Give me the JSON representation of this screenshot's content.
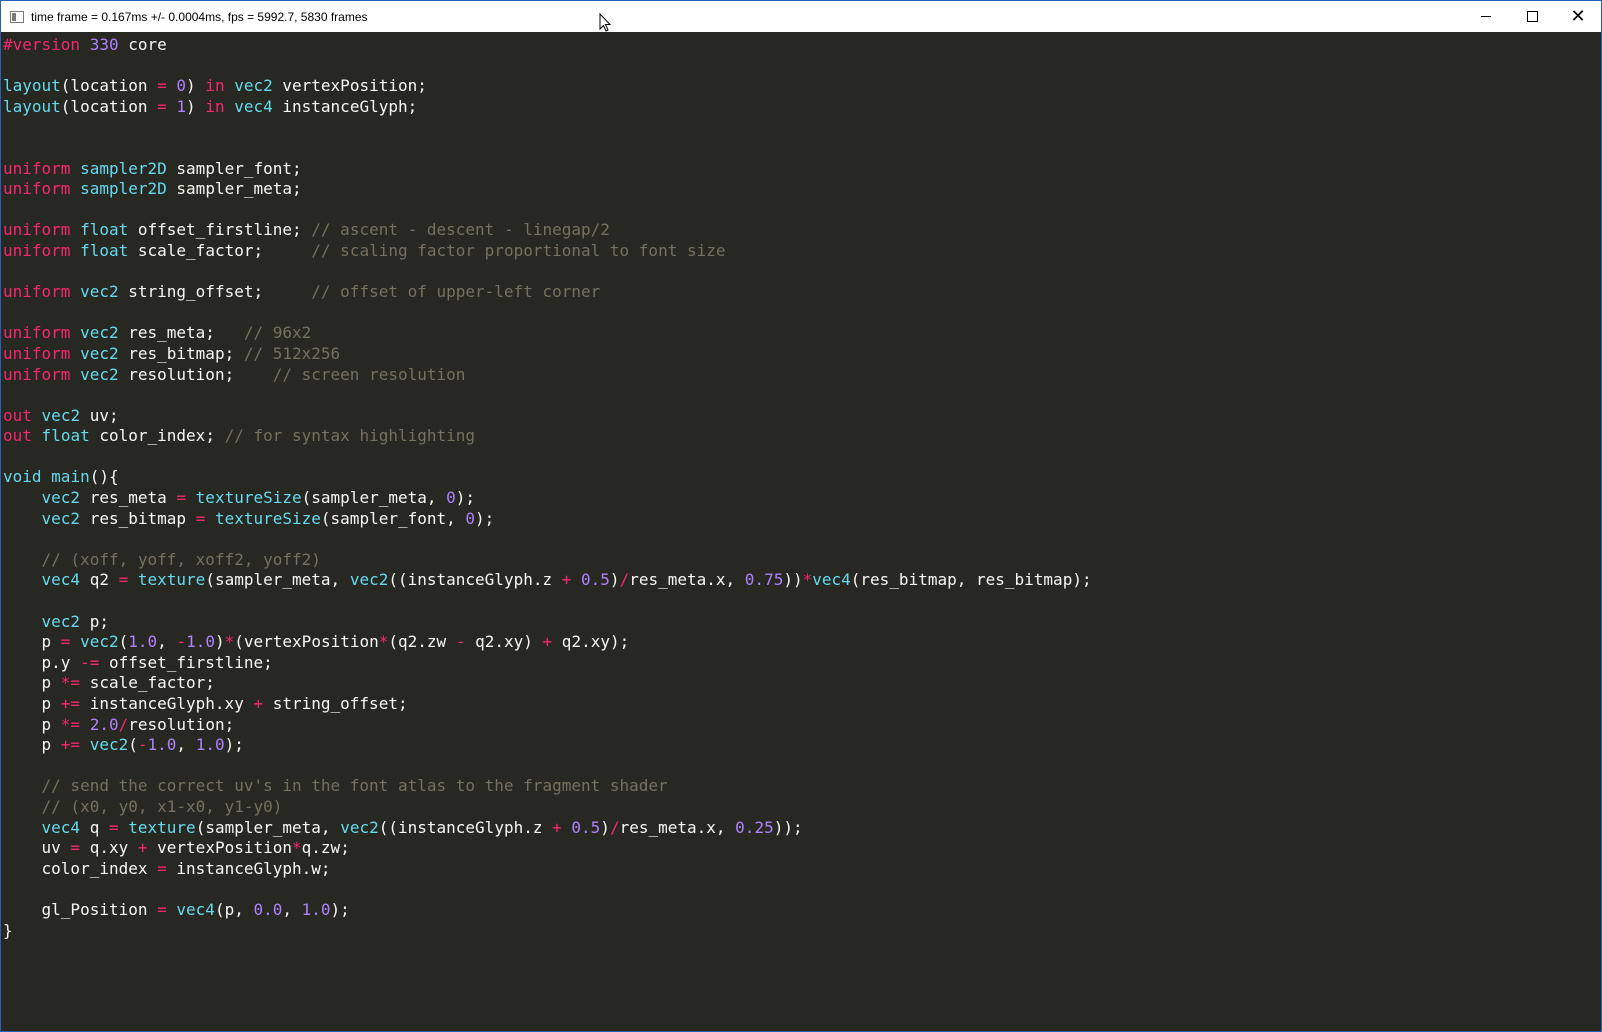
{
  "window": {
    "title": "time frame = 0.167ms +/- 0.0004ms, fps = 5992.7, 5830 frames",
    "controls": {
      "minimize": "minimize",
      "maximize": "maximize",
      "close": "close"
    }
  },
  "colors": {
    "background": "#272822",
    "keyword": "#f92672",
    "type": "#66d9ef",
    "number": "#ae81ff",
    "comment": "#75715e",
    "text": "#f8f8f2"
  },
  "editor": {
    "lines": [
      [
        [
          "kw",
          "#version "
        ],
        [
          "num",
          "330"
        ],
        [
          "tx",
          " core"
        ]
      ],
      [],
      [
        [
          "ty",
          "layout"
        ],
        [
          "tx",
          "(location "
        ],
        [
          "op",
          "="
        ],
        [
          "tx",
          " "
        ],
        [
          "num",
          "0"
        ],
        [
          "tx",
          ") "
        ],
        [
          "kw",
          "in"
        ],
        [
          "tx",
          " "
        ],
        [
          "ty",
          "vec2"
        ],
        [
          "tx",
          " vertexPosition;"
        ]
      ],
      [
        [
          "ty",
          "layout"
        ],
        [
          "tx",
          "(location "
        ],
        [
          "op",
          "="
        ],
        [
          "tx",
          " "
        ],
        [
          "num",
          "1"
        ],
        [
          "tx",
          ") "
        ],
        [
          "kw",
          "in"
        ],
        [
          "tx",
          " "
        ],
        [
          "ty",
          "vec4"
        ],
        [
          "tx",
          " instanceGlyph;"
        ]
      ],
      [],
      [],
      [
        [
          "kw",
          "uniform"
        ],
        [
          "tx",
          " "
        ],
        [
          "ty",
          "sampler2D"
        ],
        [
          "tx",
          " sampler_font;"
        ]
      ],
      [
        [
          "kw",
          "uniform"
        ],
        [
          "tx",
          " "
        ],
        [
          "ty",
          "sampler2D"
        ],
        [
          "tx",
          " sampler_meta;"
        ]
      ],
      [],
      [
        [
          "kw",
          "uniform"
        ],
        [
          "tx",
          " "
        ],
        [
          "ty",
          "float"
        ],
        [
          "tx",
          " offset_firstline; "
        ],
        [
          "cm",
          "// ascent - descent - linegap/2"
        ]
      ],
      [
        [
          "kw",
          "uniform"
        ],
        [
          "tx",
          " "
        ],
        [
          "ty",
          "float"
        ],
        [
          "tx",
          " scale_factor;     "
        ],
        [
          "cm",
          "// scaling factor proportional to font size"
        ]
      ],
      [],
      [
        [
          "kw",
          "uniform"
        ],
        [
          "tx",
          " "
        ],
        [
          "ty",
          "vec2"
        ],
        [
          "tx",
          " string_offset;     "
        ],
        [
          "cm",
          "// offset of upper-left corner"
        ]
      ],
      [],
      [
        [
          "kw",
          "uniform"
        ],
        [
          "tx",
          " "
        ],
        [
          "ty",
          "vec2"
        ],
        [
          "tx",
          " res_meta;   "
        ],
        [
          "cm",
          "// 96x2"
        ]
      ],
      [
        [
          "kw",
          "uniform"
        ],
        [
          "tx",
          " "
        ],
        [
          "ty",
          "vec2"
        ],
        [
          "tx",
          " res_bitmap; "
        ],
        [
          "cm",
          "// 512x256"
        ]
      ],
      [
        [
          "kw",
          "uniform"
        ],
        [
          "tx",
          " "
        ],
        [
          "ty",
          "vec2"
        ],
        [
          "tx",
          " resolution;    "
        ],
        [
          "cm",
          "// screen resolution"
        ]
      ],
      [],
      [
        [
          "kw",
          "out"
        ],
        [
          "tx",
          " "
        ],
        [
          "ty",
          "vec2"
        ],
        [
          "tx",
          " uv;"
        ]
      ],
      [
        [
          "kw",
          "out"
        ],
        [
          "tx",
          " "
        ],
        [
          "ty",
          "float"
        ],
        [
          "tx",
          " color_index; "
        ],
        [
          "cm",
          "// for syntax highlighting"
        ]
      ],
      [],
      [
        [
          "ty",
          "void"
        ],
        [
          "tx",
          " "
        ],
        [
          "ty",
          "main"
        ],
        [
          "tx",
          "(){"
        ]
      ],
      [
        [
          "tx",
          "    "
        ],
        [
          "ty",
          "vec2"
        ],
        [
          "tx",
          " res_meta "
        ],
        [
          "op",
          "="
        ],
        [
          "tx",
          " "
        ],
        [
          "fn",
          "textureSize"
        ],
        [
          "tx",
          "(sampler_meta, "
        ],
        [
          "num",
          "0"
        ],
        [
          "tx",
          ");"
        ]
      ],
      [
        [
          "tx",
          "    "
        ],
        [
          "ty",
          "vec2"
        ],
        [
          "tx",
          " res_bitmap "
        ],
        [
          "op",
          "="
        ],
        [
          "tx",
          " "
        ],
        [
          "fn",
          "textureSize"
        ],
        [
          "tx",
          "(sampler_font, "
        ],
        [
          "num",
          "0"
        ],
        [
          "tx",
          ");"
        ]
      ],
      [],
      [
        [
          "tx",
          "    "
        ],
        [
          "cm",
          "// (xoff, yoff, xoff2, yoff2)"
        ]
      ],
      [
        [
          "tx",
          "    "
        ],
        [
          "ty",
          "vec4"
        ],
        [
          "tx",
          " q2 "
        ],
        [
          "op",
          "="
        ],
        [
          "tx",
          " "
        ],
        [
          "fn",
          "texture"
        ],
        [
          "tx",
          "(sampler_meta, "
        ],
        [
          "ty",
          "vec2"
        ],
        [
          "tx",
          "((instanceGlyph.z "
        ],
        [
          "op",
          "+"
        ],
        [
          "tx",
          " "
        ],
        [
          "num",
          "0.5"
        ],
        [
          "tx",
          ")"
        ],
        [
          "op",
          "/"
        ],
        [
          "tx",
          "res_meta.x, "
        ],
        [
          "num",
          "0.75"
        ],
        [
          "tx",
          "))"
        ],
        [
          "op",
          "*"
        ],
        [
          "ty",
          "vec4"
        ],
        [
          "tx",
          "(res_bitmap, res_bitmap);"
        ]
      ],
      [],
      [
        [
          "tx",
          "    "
        ],
        [
          "ty",
          "vec2"
        ],
        [
          "tx",
          " p;"
        ]
      ],
      [
        [
          "tx",
          "    p "
        ],
        [
          "op",
          "="
        ],
        [
          "tx",
          " "
        ],
        [
          "ty",
          "vec2"
        ],
        [
          "tx",
          "("
        ],
        [
          "num",
          "1.0"
        ],
        [
          "tx",
          ", "
        ],
        [
          "op",
          "-"
        ],
        [
          "num",
          "1.0"
        ],
        [
          "tx",
          ")"
        ],
        [
          "op",
          "*"
        ],
        [
          "tx",
          "(vertexPosition"
        ],
        [
          "op",
          "*"
        ],
        [
          "tx",
          "(q2.zw "
        ],
        [
          "op",
          "-"
        ],
        [
          "tx",
          " q2.xy) "
        ],
        [
          "op",
          "+"
        ],
        [
          "tx",
          " q2.xy);"
        ]
      ],
      [
        [
          "tx",
          "    p.y "
        ],
        [
          "op",
          "-="
        ],
        [
          "tx",
          " offset_firstline;"
        ]
      ],
      [
        [
          "tx",
          "    p "
        ],
        [
          "op",
          "*="
        ],
        [
          "tx",
          " scale_factor;"
        ]
      ],
      [
        [
          "tx",
          "    p "
        ],
        [
          "op",
          "+="
        ],
        [
          "tx",
          " instanceGlyph.xy "
        ],
        [
          "op",
          "+"
        ],
        [
          "tx",
          " string_offset;"
        ]
      ],
      [
        [
          "tx",
          "    p "
        ],
        [
          "op",
          "*="
        ],
        [
          "tx",
          " "
        ],
        [
          "num",
          "2.0"
        ],
        [
          "op",
          "/"
        ],
        [
          "tx",
          "resolution;"
        ]
      ],
      [
        [
          "tx",
          "    p "
        ],
        [
          "op",
          "+="
        ],
        [
          "tx",
          " "
        ],
        [
          "ty",
          "vec2"
        ],
        [
          "tx",
          "("
        ],
        [
          "op",
          "-"
        ],
        [
          "num",
          "1.0"
        ],
        [
          "tx",
          ", "
        ],
        [
          "num",
          "1.0"
        ],
        [
          "tx",
          ");"
        ]
      ],
      [],
      [
        [
          "tx",
          "    "
        ],
        [
          "cm",
          "// send the correct uv's in the font atlas to the fragment shader"
        ]
      ],
      [
        [
          "tx",
          "    "
        ],
        [
          "cm",
          "// (x0, y0, x1-x0, y1-y0)"
        ]
      ],
      [
        [
          "tx",
          "    "
        ],
        [
          "ty",
          "vec4"
        ],
        [
          "tx",
          " q "
        ],
        [
          "op",
          "="
        ],
        [
          "tx",
          " "
        ],
        [
          "fn",
          "texture"
        ],
        [
          "tx",
          "(sampler_meta, "
        ],
        [
          "ty",
          "vec2"
        ],
        [
          "tx",
          "((instanceGlyph.z "
        ],
        [
          "op",
          "+"
        ],
        [
          "tx",
          " "
        ],
        [
          "num",
          "0.5"
        ],
        [
          "tx",
          ")"
        ],
        [
          "op",
          "/"
        ],
        [
          "tx",
          "res_meta.x, "
        ],
        [
          "num",
          "0.25"
        ],
        [
          "tx",
          "));"
        ]
      ],
      [
        [
          "tx",
          "    uv "
        ],
        [
          "op",
          "="
        ],
        [
          "tx",
          " q.xy "
        ],
        [
          "op",
          "+"
        ],
        [
          "tx",
          " vertexPosition"
        ],
        [
          "op",
          "*"
        ],
        [
          "tx",
          "q.zw;"
        ]
      ],
      [
        [
          "tx",
          "    color_index "
        ],
        [
          "op",
          "="
        ],
        [
          "tx",
          " instanceGlyph.w;"
        ]
      ],
      [],
      [
        [
          "tx",
          "    gl_Position "
        ],
        [
          "op",
          "="
        ],
        [
          "tx",
          " "
        ],
        [
          "ty",
          "vec4"
        ],
        [
          "tx",
          "(p, "
        ],
        [
          "num",
          "0.0"
        ],
        [
          "tx",
          ", "
        ],
        [
          "num",
          "1.0"
        ],
        [
          "tx",
          ");"
        ]
      ],
      [
        [
          "tx",
          "}"
        ]
      ]
    ]
  }
}
